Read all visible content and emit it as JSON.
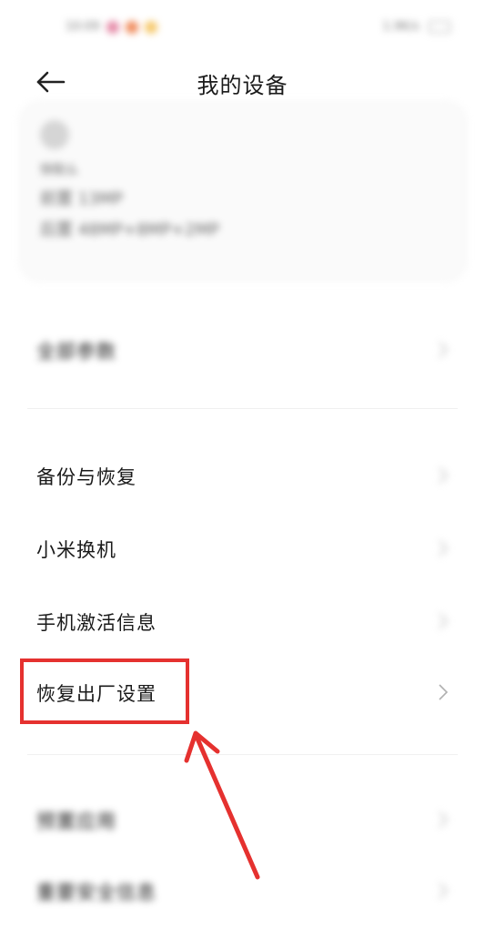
{
  "status_bar": {
    "time": "10:09",
    "right_text": "1.9K/s"
  },
  "header": {
    "title": "我的设备",
    "back_icon": "arrow-left-icon"
  },
  "device_card": {
    "name": "快取么",
    "front_camera": "前置 13MP",
    "rear_camera": "后置 48MP+8MP+2MP"
  },
  "menu": {
    "all_params": "全部参数",
    "backup_restore": "备份与恢复",
    "mi_mover": "小米换机",
    "activation_info": "手机激活信息",
    "factory_reset": "恢复出厂设置",
    "preinstalled_apps": "预置应用",
    "safety_info": "重要安全信息"
  },
  "annotation": {
    "highlight_color": "#e5312f"
  }
}
